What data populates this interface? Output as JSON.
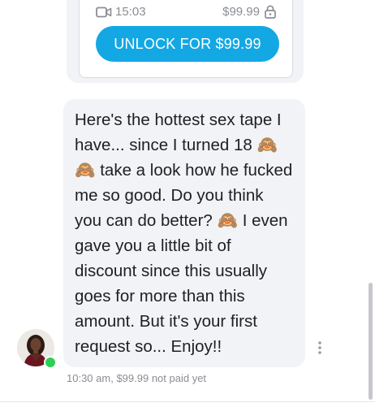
{
  "media_card": {
    "duration": "15:03",
    "price": "$99.99",
    "unlock_label": "UNLOCK FOR $99.99"
  },
  "message": {
    "text": "Here's the hottest sex tape I have... since I turned 18 🙈 🙈 take a look how he fucked me so good. Do you think you can do better? 🙈 I even gave you a little bit of discount since this usually goes for more than this amount. But it's your first request so... Enjoy!!",
    "time": "10:30 am,",
    "price_status": "$99.99 not paid yet"
  },
  "icons": {
    "video": "video-camera-icon",
    "lock": "lock-icon",
    "more": "more-vertical-icon"
  },
  "colors": {
    "accent": "#13a8e4",
    "bubble": "#f2f3f6",
    "online": "#2fcf55",
    "muted_text": "#8a8d93"
  }
}
